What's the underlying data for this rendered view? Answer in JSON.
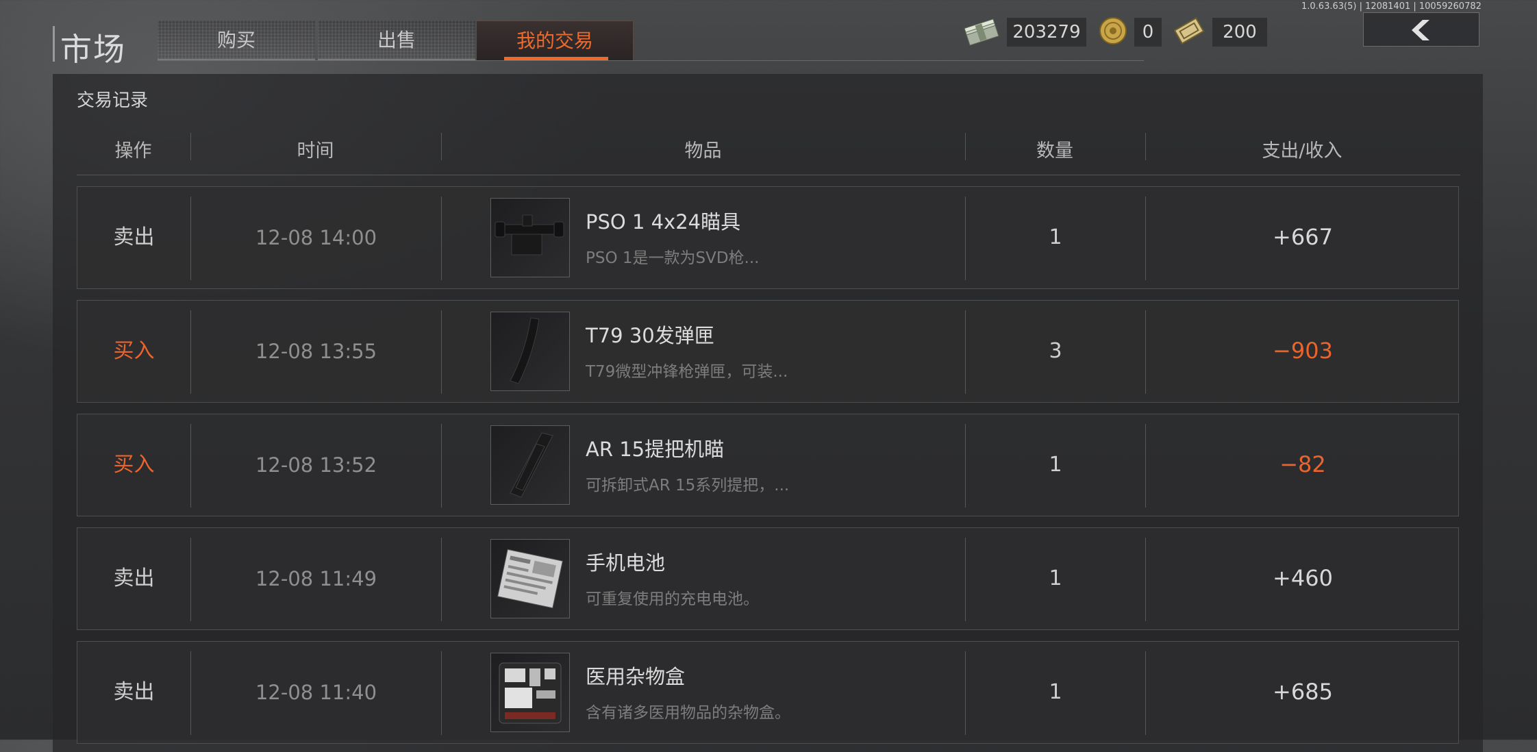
{
  "header": {
    "title": "市场",
    "tabs": [
      {
        "label": "购买",
        "active": false
      },
      {
        "label": "出售",
        "active": false
      },
      {
        "label": "我的交易",
        "active": true
      }
    ],
    "currencies": [
      {
        "icon": "cash-stack-icon",
        "value": "203279"
      },
      {
        "icon": "gold-coin-icon",
        "value": "0"
      },
      {
        "icon": "ticket-icon",
        "value": "200"
      }
    ],
    "version": "1.0.63.63(5) | 12081401 | 10059260782",
    "back_icon": "chevron-left-icon"
  },
  "records": {
    "section_title": "交易记录",
    "columns": {
      "op": "操作",
      "time": "时间",
      "item": "物品",
      "qty": "数量",
      "amount": "支出/收入"
    },
    "rows": [
      {
        "op": "卖出",
        "type": "sell",
        "time": "12-08 14:00",
        "name": "PSO 1 4x24瞄具",
        "desc": "PSO 1是一款为SVD枪...",
        "qty": "1",
        "amount": "+667",
        "thumb": "scope-icon"
      },
      {
        "op": "买入",
        "type": "buy",
        "time": "12-08 13:55",
        "name": "T79 30发弹匣",
        "desc": "T79微型冲锋枪弹匣，可装...",
        "qty": "3",
        "amount": "−903",
        "thumb": "magazine-icon"
      },
      {
        "op": "买入",
        "type": "buy",
        "time": "12-08 13:52",
        "name": "AR 15提把机瞄",
        "desc": "可拆卸式AR 15系列提把，...",
        "qty": "1",
        "amount": "−82",
        "thumb": "carry-handle-sight-icon"
      },
      {
        "op": "卖出",
        "type": "sell",
        "time": "12-08 11:49",
        "name": "手机电池",
        "desc": "可重复使用的充电电池。",
        "qty": "1",
        "amount": "+460",
        "thumb": "phone-battery-icon"
      },
      {
        "op": "卖出",
        "type": "sell",
        "time": "12-08 11:40",
        "name": "医用杂物盒",
        "desc": "含有诸多医用物品的杂物盒。",
        "qty": "1",
        "amount": "+685",
        "thumb": "medical-case-icon"
      }
    ]
  },
  "colors": {
    "accent": "#ee6a2c",
    "text": "#d0d0d0",
    "muted": "#8f8f8f"
  }
}
